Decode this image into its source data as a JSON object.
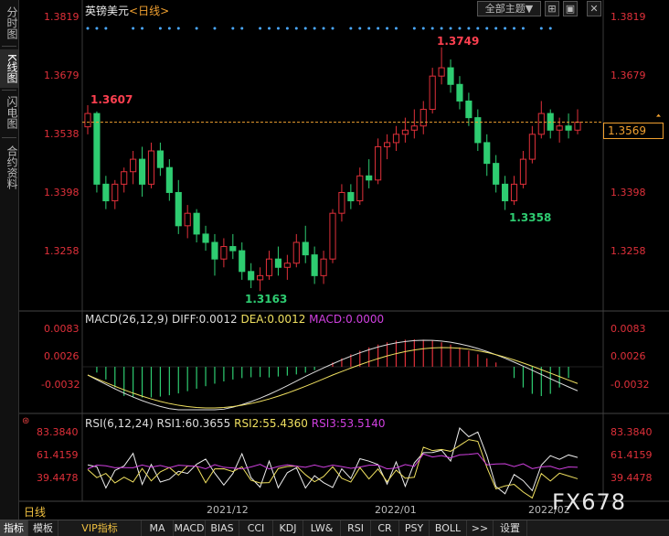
{
  "left_tabs": [
    "分时图",
    "K线图",
    "闪电图",
    "合约资料"
  ],
  "left_tab_active": 1,
  "header": {
    "symbol": "英镑美元",
    "period_tag": "<日线>",
    "topic_button": "全部主题▼"
  },
  "price_axis": {
    "labels": [
      "1.3819",
      "1.3679",
      "1.3538",
      "1.3398",
      "1.3258"
    ],
    "current_price": "1.3569",
    "colors": {
      "up": "#e0303a",
      "down": "#2ecc71",
      "current": "#f0a030"
    }
  },
  "annotations": {
    "high_left": "1.3607",
    "high": "1.3749",
    "low": "1.3163",
    "low_right": "1.3358"
  },
  "macd": {
    "title": "MACD(26,12,9)",
    "diff": "DIFF:0.0012",
    "dea": "DEA:0.0012",
    "macd": "MACD:0.0000",
    "labels": [
      "0.0083",
      "0.0026",
      "-0.0032"
    ]
  },
  "rsi": {
    "title": "RSI(6,12,24)",
    "rsi1": "RSI1:60.3655",
    "rsi2": "RSI2:55.4360",
    "rsi3": "RSI3:53.5140",
    "labels": [
      "83.3840",
      "61.4159",
      "39.4478"
    ]
  },
  "dates": [
    "2021/12",
    "2022/01",
    "2022/02"
  ],
  "period_label": "日线",
  "watermark": "FX678",
  "toolbar": [
    "指标",
    "模板",
    "VIP指标",
    "MA",
    "MACD",
    "BIAS",
    "CCI",
    "KDJ",
    "LW&",
    "RSI",
    "CR",
    "PSY",
    "BOLL",
    ">>",
    "设置"
  ],
  "toolbar_active": 0,
  "chart_data": {
    "type": "candlestick",
    "candles": [
      [
        1.3558,
        1.361,
        1.354,
        1.359
      ],
      [
        1.359,
        1.3595,
        1.34,
        1.342
      ],
      [
        1.342,
        1.344,
        1.336,
        1.338
      ],
      [
        1.338,
        1.343,
        1.336,
        1.342
      ],
      [
        1.342,
        1.346,
        1.34,
        1.345
      ],
      [
        1.345,
        1.35,
        1.342,
        1.348
      ],
      [
        1.348,
        1.351,
        1.339,
        1.342
      ],
      [
        1.342,
        1.352,
        1.341,
        1.35
      ],
      [
        1.35,
        1.352,
        1.344,
        1.346
      ],
      [
        1.346,
        1.348,
        1.338,
        1.34
      ],
      [
        1.34,
        1.343,
        1.33,
        1.332
      ],
      [
        1.332,
        1.337,
        1.329,
        1.335
      ],
      [
        1.335,
        1.336,
        1.328,
        1.33
      ],
      [
        1.33,
        1.332,
        1.326,
        1.328
      ],
      [
        1.328,
        1.33,
        1.32,
        1.324
      ],
      [
        1.324,
        1.329,
        1.322,
        1.327
      ],
      [
        1.327,
        1.33,
        1.324,
        1.326
      ],
      [
        1.326,
        1.328,
        1.319,
        1.321
      ],
      [
        1.321,
        1.323,
        1.317,
        1.319
      ],
      [
        1.319,
        1.322,
        1.3163,
        1.32
      ],
      [
        1.32,
        1.326,
        1.319,
        1.324
      ],
      [
        1.324,
        1.327,
        1.32,
        1.322
      ],
      [
        1.322,
        1.325,
        1.319,
        1.323
      ],
      [
        1.323,
        1.33,
        1.322,
        1.328
      ],
      [
        1.328,
        1.332,
        1.323,
        1.325
      ],
      [
        1.325,
        1.327,
        1.318,
        1.32
      ],
      [
        1.32,
        1.326,
        1.318,
        1.324
      ],
      [
        1.324,
        1.336,
        1.323,
        1.335
      ],
      [
        1.335,
        1.342,
        1.333,
        1.34
      ],
      [
        1.34,
        1.342,
        1.336,
        1.338
      ],
      [
        1.338,
        1.346,
        1.337,
        1.344
      ],
      [
        1.344,
        1.348,
        1.341,
        1.343
      ],
      [
        1.343,
        1.353,
        1.342,
        1.351
      ],
      [
        1.351,
        1.354,
        1.348,
        1.352
      ],
      [
        1.352,
        1.356,
        1.35,
        1.354
      ],
      [
        1.354,
        1.358,
        1.352,
        1.355
      ],
      [
        1.355,
        1.36,
        1.353,
        1.356
      ],
      [
        1.356,
        1.362,
        1.354,
        1.36
      ],
      [
        1.36,
        1.37,
        1.359,
        1.368
      ],
      [
        1.368,
        1.3749,
        1.366,
        1.37
      ],
      [
        1.37,
        1.372,
        1.364,
        1.366
      ],
      [
        1.366,
        1.368,
        1.36,
        1.362
      ],
      [
        1.362,
        1.364,
        1.356,
        1.358
      ],
      [
        1.358,
        1.36,
        1.35,
        1.352
      ],
      [
        1.352,
        1.354,
        1.344,
        1.347
      ],
      [
        1.347,
        1.349,
        1.34,
        1.342
      ],
      [
        1.342,
        1.344,
        1.3358,
        1.338
      ],
      [
        1.338,
        1.344,
        1.337,
        1.342
      ],
      [
        1.342,
        1.35,
        1.341,
        1.348
      ],
      [
        1.348,
        1.356,
        1.347,
        1.354
      ],
      [
        1.354,
        1.362,
        1.353,
        1.359
      ],
      [
        1.359,
        1.36,
        1.353,
        1.355
      ],
      [
        1.355,
        1.358,
        1.352,
        1.356
      ],
      [
        1.356,
        1.359,
        1.353,
        1.355
      ],
      [
        1.355,
        1.36,
        1.354,
        1.3569
      ]
    ],
    "ylim": [
      1.314,
      1.384
    ]
  }
}
